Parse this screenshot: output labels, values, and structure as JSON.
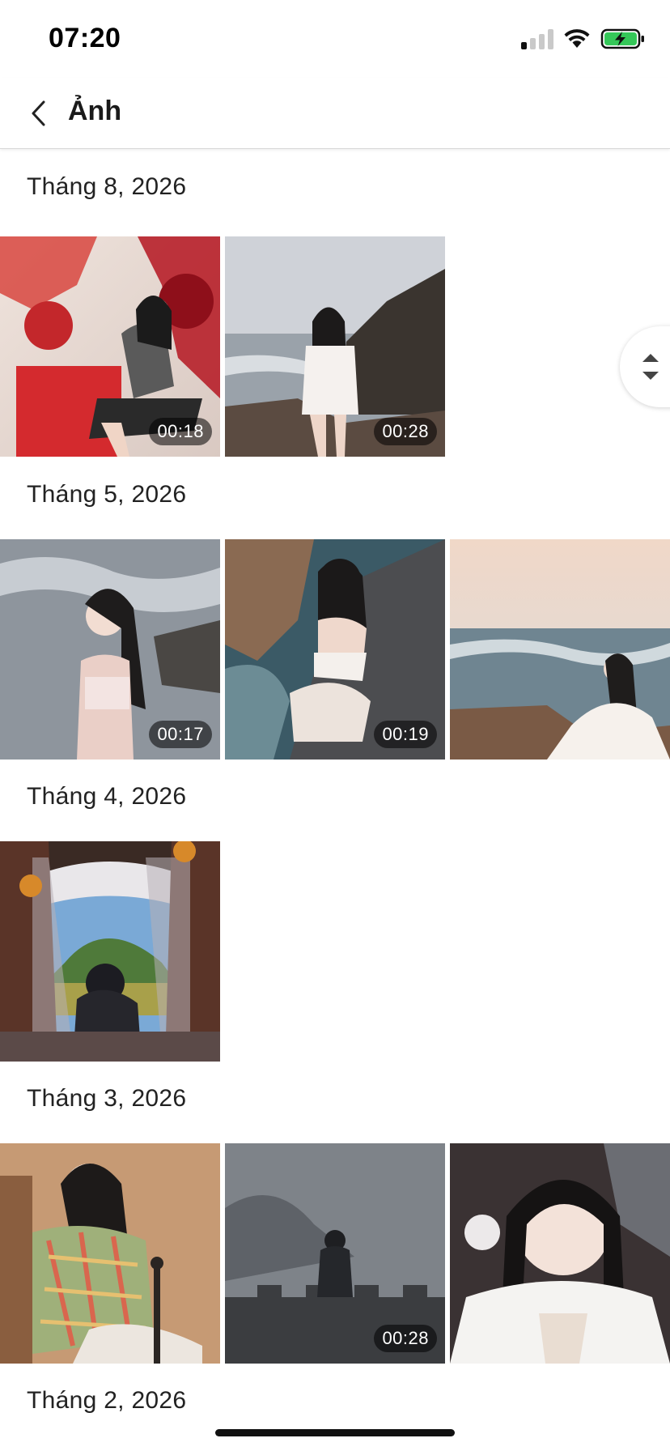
{
  "status_bar": {
    "time": "07:20",
    "signal_bars_active": 1,
    "signal_bars_total": 4,
    "battery_color": "#35c759",
    "charging": true
  },
  "nav": {
    "back_icon": "chevron-left-icon",
    "title": "Ảnh"
  },
  "sections": [
    {
      "heading": "Tháng 8, 2026",
      "items": [
        {
          "duration": "00:18",
          "is_video": true
        },
        {
          "duration": "00:28",
          "is_video": true
        }
      ]
    },
    {
      "heading": "Tháng 5, 2026",
      "items": [
        {
          "duration": "00:17",
          "is_video": true
        },
        {
          "duration": "00:19",
          "is_video": true
        },
        {
          "duration": "",
          "is_video": false
        }
      ]
    },
    {
      "heading": "Tháng 4, 2026",
      "items": [
        {
          "duration": "",
          "is_video": false
        }
      ]
    },
    {
      "heading": "Tháng 3, 2026",
      "items": [
        {
          "duration": "",
          "is_video": false
        },
        {
          "duration": "00:28",
          "is_video": true
        },
        {
          "duration": "",
          "is_video": false
        }
      ]
    },
    {
      "heading": "Tháng 2, 2026",
      "items": []
    }
  ],
  "fast_scroll_icon": "scroll-up-down-icon"
}
